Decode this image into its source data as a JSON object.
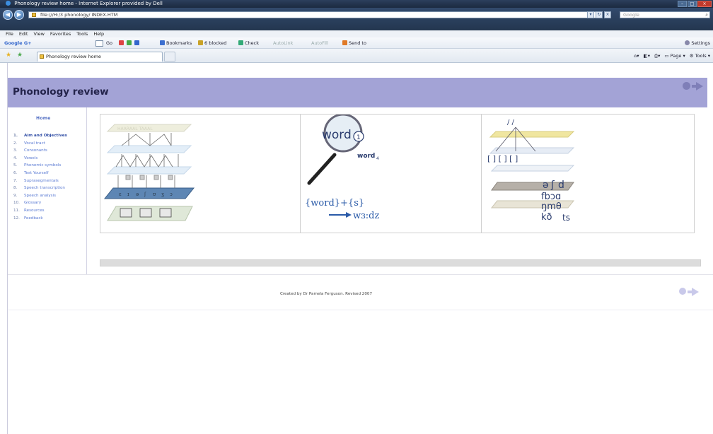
{
  "browser": {
    "title": "Phonology review home - Internet Explorer provided by Dell",
    "address": "file:///H:/3 phonology/ INDEX.HTM",
    "search_placeholder": "Google",
    "menu": [
      "File",
      "Edit",
      "View",
      "Favorites",
      "Tools",
      "Help"
    ],
    "google_toolbar": {
      "logo": "Google G+",
      "go": "Go",
      "bookmarks": "Bookmarks",
      "blocked": "6 blocked",
      "check": "Check",
      "autolink": "AutoLink",
      "autofill": "AutoFill",
      "send_to": "Send to",
      "settings": "Settings"
    },
    "tab_label": "Phonology review home",
    "command_bar": {
      "page": "Page",
      "tools": "Tools"
    }
  },
  "page": {
    "banner_title": "Phonology review",
    "menu_heading": "Home",
    "menu_items": [
      {
        "num": "1.",
        "label": "Aim and Objectives"
      },
      {
        "num": "2.",
        "label": "Vocal tract"
      },
      {
        "num": "3.",
        "label": "Consonants"
      },
      {
        "num": "4.",
        "label": "Vowels"
      },
      {
        "num": "5.",
        "label": "Phonemic symbols"
      },
      {
        "num": "6.",
        "label": "Test Yourself"
      },
      {
        "num": "7.",
        "label": "Suprasegmentals"
      },
      {
        "num": "8.",
        "label": "Speech transcription"
      },
      {
        "num": "9.",
        "label": "Speech analysis"
      },
      {
        "num": "10.",
        "label": "Glossary"
      },
      {
        "num": "11.",
        "label": "Resources"
      },
      {
        "num": "12.",
        "label": "Feedback"
      }
    ],
    "illustration2": {
      "word1": "word",
      "sub1": "1",
      "word2": "word",
      "sub2": "4",
      "morph": "{word}+{s}",
      "phon": "wɜ:dz"
    },
    "illustration3": {
      "slashes": "/  /",
      "brackets": "[ ] [ ] [ ]",
      "sym1": "ə",
      "sym2": "ʃ",
      "sym3": "d",
      "sym4": "fbɔɑ",
      "sym5": "ŋmθ",
      "sym6": "kð",
      "sym7": "ts"
    },
    "footer_text": "Created by Dr Pamela Ferguson. Revised 2007"
  }
}
